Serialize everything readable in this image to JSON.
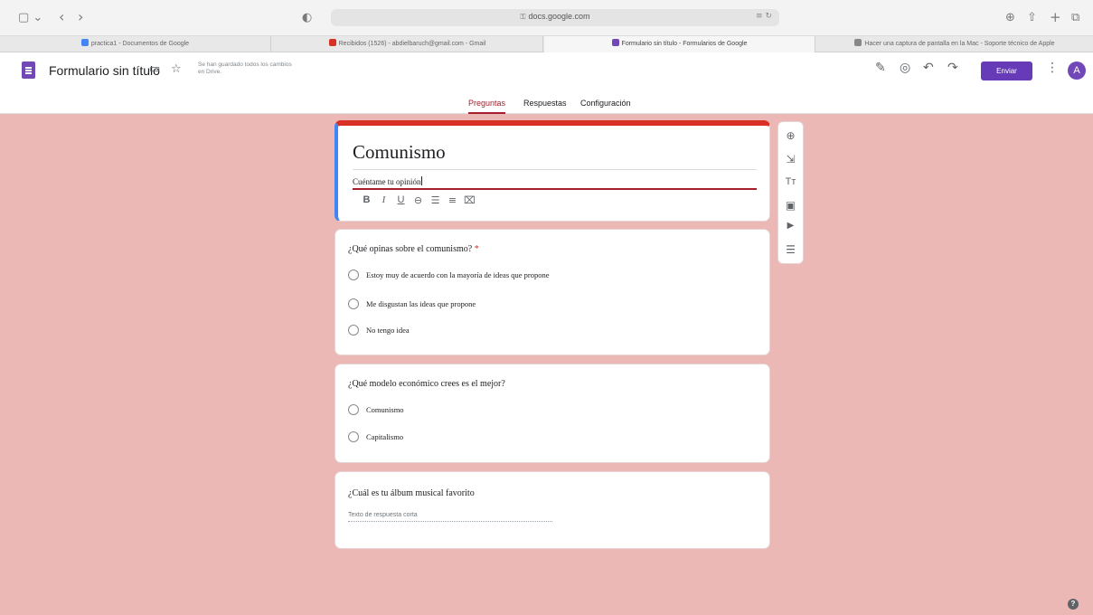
{
  "browser": {
    "address": "docs.google.com",
    "tabs": [
      {
        "label": "practica1 - Documentos de Google",
        "color": "#4285f4"
      },
      {
        "label": "Recibidos (1526) - abdielbaruch@gmail.com - Gmail",
        "color": "#d93025"
      },
      {
        "label": "Formulario sin título - Formularios de Google",
        "color": "#7248b9"
      },
      {
        "label": "Hacer una captura de pantalla en la Mac - Soporte técnico de Apple",
        "color": "#888888"
      }
    ],
    "icons": {
      "sidebar": "▢ ⌄",
      "back": "‹",
      "forward": "›",
      "shield": "◐",
      "lock": "🔒",
      "reader": "≡ ↻",
      "download": "⊕",
      "share": "⇧",
      "new_tab": "+",
      "tabs_overview": "⧉"
    }
  },
  "header": {
    "title": "Formulario sin título",
    "saved_status": "Se han guardado todos los cambios en Drive.",
    "send_label": "Enviar",
    "avatar_letter": "A",
    "icons": {
      "folder": "▭",
      "star": "☆",
      "palette": "✎",
      "preview": "◎",
      "undo": "↶",
      "redo": "↷",
      "more": "⋮"
    },
    "tabs": [
      {
        "label": "Preguntas",
        "active": true
      },
      {
        "label": "Respuestas",
        "active": false
      },
      {
        "label": "Configuración",
        "active": false
      }
    ]
  },
  "form": {
    "title": "Comunismo",
    "description": "Cuéntame tu opinión",
    "format_tools": [
      "B",
      "I",
      "U",
      "⊖",
      "☰",
      "≡",
      "⌧"
    ],
    "questions": [
      {
        "title": "¿Qué opinas sobre el comunismo?",
        "required_mark": "*",
        "options": [
          "Estoy muy de acuerdo con la mayoría de ideas que propone",
          "Me disgustan las ideas que propone",
          "No tengo idea"
        ]
      },
      {
        "title": "¿Qué modelo económico crees es el mejor?",
        "options": [
          "Comunismo",
          "Capitalismo"
        ]
      },
      {
        "title": "¿Cuál es tu álbum musical favorito",
        "placeholder": "Texto de respuesta corta"
      }
    ]
  },
  "toolbar": {
    "items": [
      {
        "name": "add-question",
        "glyph": "⊕"
      },
      {
        "name": "import-questions",
        "glyph": "⇲"
      },
      {
        "name": "add-title",
        "glyph": "Tт"
      },
      {
        "name": "add-image",
        "glyph": "▣"
      },
      {
        "name": "add-video",
        "glyph": "▶"
      },
      {
        "name": "add-section",
        "glyph": "☰"
      }
    ]
  },
  "help_label": "?",
  "colors": {
    "background": "#ebb8b6",
    "accent": "#673ab7",
    "active_tab": "#a31f2b",
    "title_border": "#d93025"
  }
}
